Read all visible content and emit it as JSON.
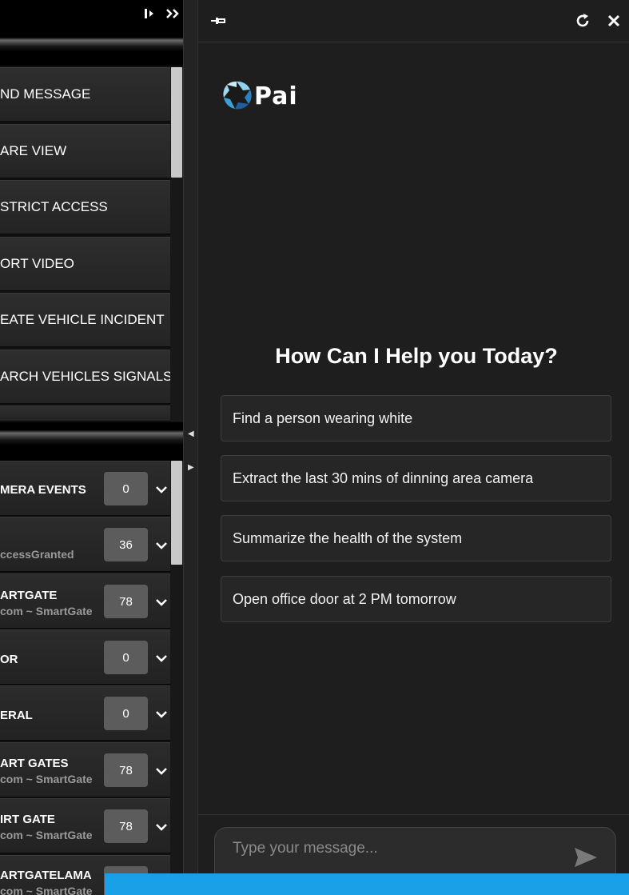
{
  "left_panel": {
    "menu_items": [
      "ND MESSAGE",
      "ARE VIEW",
      "STRICT ACCESS",
      "ORT VIDEO",
      "EATE VEHICLE INCIDENT",
      "ARCH VEHICLES SIGNALS"
    ],
    "events": [
      {
        "title": "MERA EVENTS",
        "sub": "",
        "count": "0"
      },
      {
        "title": "",
        "sub": "ccessGranted",
        "count": "36"
      },
      {
        "title": "ARTGATE",
        "sub": "com ~ SmartGate",
        "count": "78"
      },
      {
        "title": "OR",
        "sub": "",
        "count": "0"
      },
      {
        "title": "ERAL",
        "sub": "",
        "count": "0"
      },
      {
        "title": "ART GATES",
        "sub": "com ~ SmartGate",
        "count": "78"
      },
      {
        "title": "IRT GATE",
        "sub": "com ~ SmartGate",
        "count": "78"
      },
      {
        "title": "ARTGATELAMA",
        "sub": "com ~ SmartGate",
        "count": ""
      }
    ]
  },
  "chat": {
    "logo_text": "Pai",
    "title": "How Can I Help you Today?",
    "suggestions": [
      "Find a person wearing white",
      "Extract the last 30 mins of dinning area camera",
      "Summarize the health of the system",
      "Open office door at 2 PM tomorrow"
    ],
    "input_placeholder": "Type your message..."
  },
  "colors": {
    "accent_blue": "#1aa0e6",
    "panel_bg": "#1e1e1e",
    "badge_bg": "#5c5c5c"
  }
}
